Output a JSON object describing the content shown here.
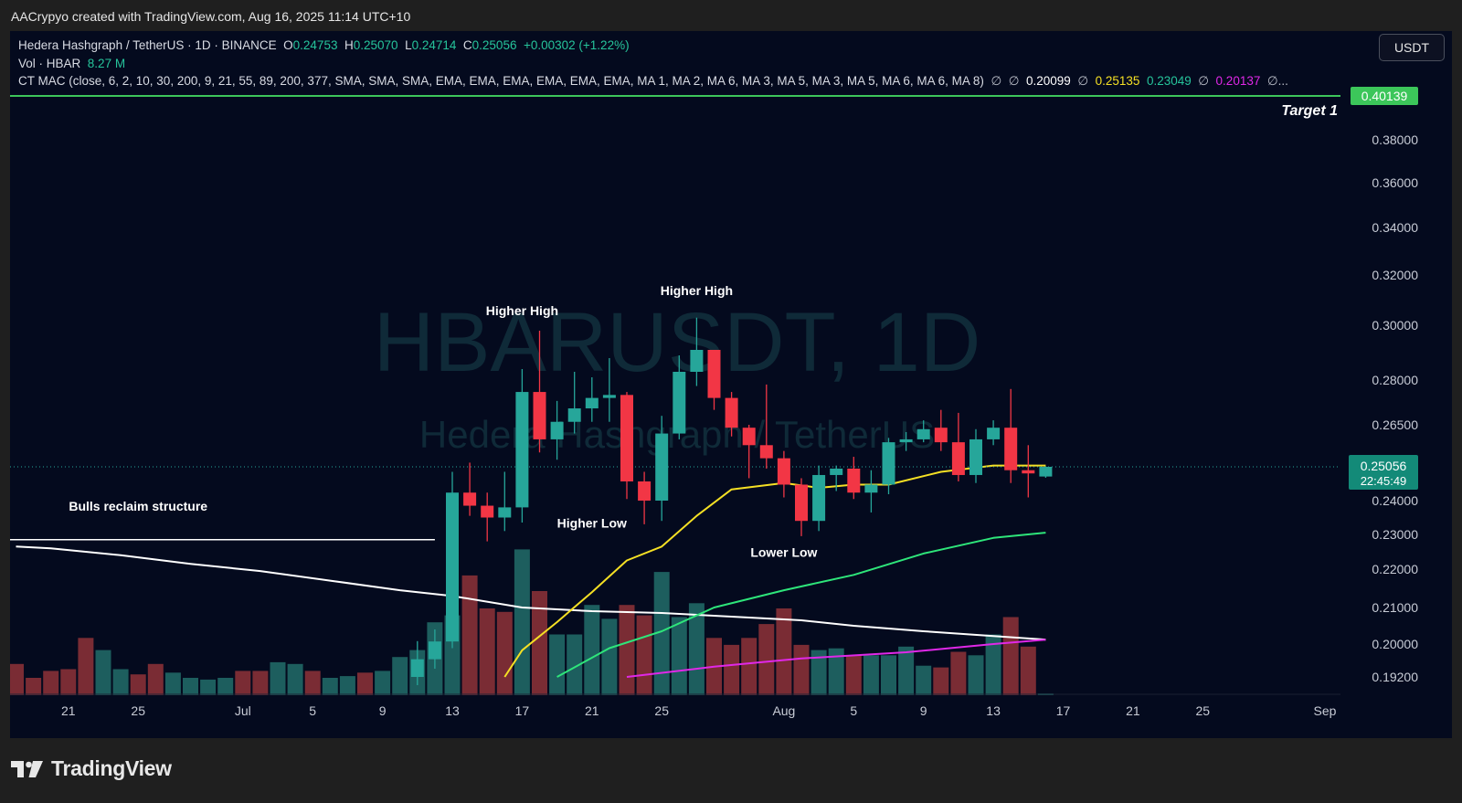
{
  "header": {
    "attribution": "AACrypyo created with TradingView.com, Aug 16, 2025 11:14 UTC+10"
  },
  "legend": {
    "symbol": "Hedera Hashgraph / TetherUS · 1D · BINANCE",
    "o_label": "O",
    "o": "0.24753",
    "h_label": "H",
    "h": "0.25070",
    "l_label": "L",
    "l": "0.24714",
    "c_label": "C",
    "c": "0.25056",
    "change": "+0.00302 (+1.22%)",
    "vol_label": "Vol · HBAR",
    "vol": "8.27 M",
    "indicator": "CT MAC (close, 6, 2, 10, 30, 200, 9, 21, 55, 89, 200, 377, SMA, SMA, SMA, EMA, EMA, EMA, EMA, EMA, EMA, MA 1, MA 2, MA 6, MA 3, MA 5, MA 3, MA 5, MA 6, MA 6, MA 8)",
    "ind_na1": "∅",
    "ind_na2": "∅",
    "ind_v1": "0.20099",
    "ind_na3": "∅",
    "ind_v2": "0.25135",
    "ind_v3": "0.23049",
    "ind_na4": "∅",
    "ind_v4": "0.20137",
    "ind_tail": "∅..."
  },
  "toolbar": {
    "currency": "USDT"
  },
  "watermark": {
    "ticker": "HBARUSDT, 1D",
    "name": "Hedera Hashgraph / TetherUS"
  },
  "colors": {
    "up": "#26a69a",
    "down": "#f23645",
    "ma_yellow": "#f5e024",
    "ma_green": "#2ee57a",
    "ma_white": "#ffffff",
    "ma_magenta": "#e028e8",
    "target": "#3cc65a"
  },
  "chart_data": {
    "type": "candlestick",
    "y_axis_ticks": [
      0.192,
      0.2,
      0.21,
      0.22,
      0.23,
      0.24,
      0.265,
      0.28,
      0.3,
      0.32,
      0.34,
      0.36,
      0.38
    ],
    "y_axis_tick_labels": [
      "0.19200",
      "0.20000",
      "0.21000",
      "0.22000",
      "0.23000",
      "0.24000",
      "0.26500",
      "0.28000",
      "0.30000",
      "0.32000",
      "0.34000",
      "0.36000",
      "0.38000"
    ],
    "x_axis_labels": [
      {
        "date": "2025-06-21",
        "label": "21"
      },
      {
        "date": "2025-06-25",
        "label": "25"
      },
      {
        "date": "2025-07-01",
        "label": "Jul"
      },
      {
        "date": "2025-07-05",
        "label": "5"
      },
      {
        "date": "2025-07-09",
        "label": "9"
      },
      {
        "date": "2025-07-13",
        "label": "13"
      },
      {
        "date": "2025-07-17",
        "label": "17"
      },
      {
        "date": "2025-07-21",
        "label": "21"
      },
      {
        "date": "2025-07-25",
        "label": "25"
      },
      {
        "date": "2025-08-01",
        "label": "Aug"
      },
      {
        "date": "2025-08-05",
        "label": "5"
      },
      {
        "date": "2025-08-09",
        "label": "9"
      },
      {
        "date": "2025-08-13",
        "label": "13"
      },
      {
        "date": "2025-08-17",
        "label": "17"
      },
      {
        "date": "2025-08-21",
        "label": "21"
      },
      {
        "date": "2025-08-25",
        "label": "25"
      },
      {
        "date": "2025-09-01",
        "label": "Sep"
      }
    ],
    "candles": [
      {
        "date": "2025-07-11",
        "o": 0.192,
        "h": 0.2008,
        "l": 0.19,
        "c": 0.1963
      },
      {
        "date": "2025-07-12",
        "o": 0.1963,
        "h": 0.204,
        "l": 0.194,
        "c": 0.2007
      },
      {
        "date": "2025-07-13",
        "o": 0.2007,
        "h": 0.249,
        "l": 0.199,
        "c": 0.2425
      },
      {
        "date": "2025-07-14",
        "o": 0.2425,
        "h": 0.252,
        "l": 0.2355,
        "c": 0.2385
      },
      {
        "date": "2025-07-15",
        "o": 0.2385,
        "h": 0.2425,
        "l": 0.228,
        "c": 0.235
      },
      {
        "date": "2025-07-16",
        "o": 0.235,
        "h": 0.249,
        "l": 0.231,
        "c": 0.238
      },
      {
        "date": "2025-07-17",
        "o": 0.238,
        "h": 0.284,
        "l": 0.2335,
        "c": 0.276
      },
      {
        "date": "2025-07-18",
        "o": 0.276,
        "h": 0.298,
        "l": 0.2555,
        "c": 0.26
      },
      {
        "date": "2025-07-19",
        "o": 0.26,
        "h": 0.273,
        "l": 0.253,
        "c": 0.266
      },
      {
        "date": "2025-07-20",
        "o": 0.266,
        "h": 0.283,
        "l": 0.262,
        "c": 0.2705
      },
      {
        "date": "2025-07-21",
        "o": 0.2705,
        "h": 0.281,
        "l": 0.266,
        "c": 0.274
      },
      {
        "date": "2025-07-22",
        "o": 0.274,
        "h": 0.288,
        "l": 0.266,
        "c": 0.275
      },
      {
        "date": "2025-07-23",
        "o": 0.275,
        "h": 0.276,
        "l": 0.2405,
        "c": 0.246
      },
      {
        "date": "2025-07-24",
        "o": 0.246,
        "h": 0.249,
        "l": 0.233,
        "c": 0.24
      },
      {
        "date": "2025-07-25",
        "o": 0.24,
        "h": 0.268,
        "l": 0.234,
        "c": 0.262
      },
      {
        "date": "2025-07-26",
        "o": 0.262,
        "h": 0.289,
        "l": 0.26,
        "c": 0.283
      },
      {
        "date": "2025-07-27",
        "o": 0.283,
        "h": 0.303,
        "l": 0.278,
        "c": 0.291
      },
      {
        "date": "2025-07-28",
        "o": 0.291,
        "h": 0.291,
        "l": 0.27,
        "c": 0.274
      },
      {
        "date": "2025-07-29",
        "o": 0.274,
        "h": 0.276,
        "l": 0.261,
        "c": 0.264
      },
      {
        "date": "2025-07-30",
        "o": 0.264,
        "h": 0.265,
        "l": 0.247,
        "c": 0.258
      },
      {
        "date": "2025-07-31",
        "o": 0.258,
        "h": 0.2785,
        "l": 0.25,
        "c": 0.2535
      },
      {
        "date": "2025-08-01",
        "o": 0.2535,
        "h": 0.256,
        "l": 0.241,
        "c": 0.245
      },
      {
        "date": "2025-08-02",
        "o": 0.245,
        "h": 0.247,
        "l": 0.2295,
        "c": 0.234
      },
      {
        "date": "2025-08-03",
        "o": 0.234,
        "h": 0.251,
        "l": 0.231,
        "c": 0.248
      },
      {
        "date": "2025-08-04",
        "o": 0.248,
        "h": 0.251,
        "l": 0.243,
        "c": 0.25
      },
      {
        "date": "2025-08-05",
        "o": 0.25,
        "h": 0.254,
        "l": 0.2405,
        "c": 0.2425
      },
      {
        "date": "2025-08-06",
        "o": 0.2425,
        "h": 0.2495,
        "l": 0.2365,
        "c": 0.245
      },
      {
        "date": "2025-08-07",
        "o": 0.245,
        "h": 0.2605,
        "l": 0.242,
        "c": 0.259
      },
      {
        "date": "2025-08-08",
        "o": 0.259,
        "h": 0.2625,
        "l": 0.256,
        "c": 0.26
      },
      {
        "date": "2025-08-09",
        "o": 0.26,
        "h": 0.2665,
        "l": 0.259,
        "c": 0.2635
      },
      {
        "date": "2025-08-10",
        "o": 0.264,
        "h": 0.27,
        "l": 0.256,
        "c": 0.259
      },
      {
        "date": "2025-08-11",
        "o": 0.259,
        "h": 0.269,
        "l": 0.246,
        "c": 0.248
      },
      {
        "date": "2025-08-12",
        "o": 0.248,
        "h": 0.2635,
        "l": 0.2455,
        "c": 0.26
      },
      {
        "date": "2025-08-13",
        "o": 0.26,
        "h": 0.2665,
        "l": 0.258,
        "c": 0.264
      },
      {
        "date": "2025-08-14",
        "o": 0.264,
        "h": 0.277,
        "l": 0.2455,
        "c": 0.2495
      },
      {
        "date": "2025-08-15",
        "o": 0.2495,
        "h": 0.258,
        "l": 0.241,
        "c": 0.2485
      },
      {
        "date": "2025-08-16",
        "o": 0.24753,
        "h": 0.2507,
        "l": 0.24714,
        "c": 0.25056
      }
    ],
    "volume_bars": [
      {
        "date": "2025-06-18",
        "v": 1.8,
        "up": false
      },
      {
        "date": "2025-06-19",
        "v": 1.0,
        "up": false
      },
      {
        "date": "2025-06-20",
        "v": 1.4,
        "up": false
      },
      {
        "date": "2025-06-21",
        "v": 1.5,
        "up": false
      },
      {
        "date": "2025-06-22",
        "v": 3.3,
        "up": false
      },
      {
        "date": "2025-06-23",
        "v": 2.6,
        "up": true
      },
      {
        "date": "2025-06-24",
        "v": 1.5,
        "up": true
      },
      {
        "date": "2025-06-25",
        "v": 1.2,
        "up": false
      },
      {
        "date": "2025-06-26",
        "v": 1.8,
        "up": false
      },
      {
        "date": "2025-06-27",
        "v": 1.3,
        "up": true
      },
      {
        "date": "2025-06-28",
        "v": 1.0,
        "up": true
      },
      {
        "date": "2025-06-29",
        "v": 0.9,
        "up": true
      },
      {
        "date": "2025-06-30",
        "v": 1.0,
        "up": true
      },
      {
        "date": "2025-07-01",
        "v": 1.4,
        "up": false
      },
      {
        "date": "2025-07-02",
        "v": 1.4,
        "up": false
      },
      {
        "date": "2025-07-03",
        "v": 1.9,
        "up": true
      },
      {
        "date": "2025-07-04",
        "v": 1.8,
        "up": true
      },
      {
        "date": "2025-07-05",
        "v": 1.4,
        "up": false
      },
      {
        "date": "2025-07-06",
        "v": 1.0,
        "up": true
      },
      {
        "date": "2025-07-07",
        "v": 1.1,
        "up": true
      },
      {
        "date": "2025-07-08",
        "v": 1.3,
        "up": false
      },
      {
        "date": "2025-07-09",
        "v": 1.4,
        "up": true
      },
      {
        "date": "2025-07-10",
        "v": 2.2,
        "up": true
      },
      {
        "date": "2025-07-11",
        "v": 2.6,
        "up": true
      },
      {
        "date": "2025-07-12",
        "v": 4.2,
        "up": true
      },
      {
        "date": "2025-07-13",
        "v": 4.6,
        "up": true
      },
      {
        "date": "2025-07-14",
        "v": 6.9,
        "up": false
      },
      {
        "date": "2025-07-15",
        "v": 5.0,
        "up": false
      },
      {
        "date": "2025-07-16",
        "v": 4.8,
        "up": false
      },
      {
        "date": "2025-07-17",
        "v": 8.4,
        "up": true
      },
      {
        "date": "2025-07-18",
        "v": 6.0,
        "up": false
      },
      {
        "date": "2025-07-19",
        "v": 3.5,
        "up": true
      },
      {
        "date": "2025-07-20",
        "v": 3.5,
        "up": true
      },
      {
        "date": "2025-07-21",
        "v": 5.2,
        "up": true
      },
      {
        "date": "2025-07-22",
        "v": 4.4,
        "up": true
      },
      {
        "date": "2025-07-23",
        "v": 5.2,
        "up": false
      },
      {
        "date": "2025-07-24",
        "v": 4.6,
        "up": false
      },
      {
        "date": "2025-07-25",
        "v": 7.1,
        "up": true
      },
      {
        "date": "2025-07-26",
        "v": 4.5,
        "up": true
      },
      {
        "date": "2025-07-27",
        "v": 5.3,
        "up": true
      },
      {
        "date": "2025-07-28",
        "v": 3.3,
        "up": false
      },
      {
        "date": "2025-07-29",
        "v": 2.9,
        "up": false
      },
      {
        "date": "2025-07-30",
        "v": 3.3,
        "up": false
      },
      {
        "date": "2025-07-31",
        "v": 4.1,
        "up": false
      },
      {
        "date": "2025-08-01",
        "v": 5.0,
        "up": false
      },
      {
        "date": "2025-08-02",
        "v": 2.9,
        "up": false
      },
      {
        "date": "2025-08-03",
        "v": 2.6,
        "up": true
      },
      {
        "date": "2025-08-04",
        "v": 2.7,
        "up": true
      },
      {
        "date": "2025-08-05",
        "v": 2.3,
        "up": false
      },
      {
        "date": "2025-08-06",
        "v": 2.3,
        "up": true
      },
      {
        "date": "2025-08-07",
        "v": 2.3,
        "up": true
      },
      {
        "date": "2025-08-08",
        "v": 2.8,
        "up": true
      },
      {
        "date": "2025-08-09",
        "v": 1.7,
        "up": true
      },
      {
        "date": "2025-08-10",
        "v": 1.6,
        "up": false
      },
      {
        "date": "2025-08-11",
        "v": 2.5,
        "up": false
      },
      {
        "date": "2025-08-12",
        "v": 2.3,
        "up": true
      },
      {
        "date": "2025-08-13",
        "v": 3.5,
        "up": true
      },
      {
        "date": "2025-08-14",
        "v": 4.5,
        "up": false
      },
      {
        "date": "2025-08-15",
        "v": 2.8,
        "up": false
      },
      {
        "date": "2025-08-16",
        "v": 0.1,
        "up": true
      }
    ],
    "moving_averages": [
      {
        "color": "#ffffff",
        "points": [
          [
            "2025-06-18",
            0.2265
          ],
          [
            "2025-06-20",
            0.226
          ],
          [
            "2025-06-24",
            0.224
          ],
          [
            "2025-06-28",
            0.2215
          ],
          [
            "2025-07-02",
            0.2195
          ],
          [
            "2025-07-06",
            0.217
          ],
          [
            "2025-07-10",
            0.2145
          ],
          [
            "2025-07-13",
            0.213
          ],
          [
            "2025-07-17",
            0.21
          ],
          [
            "2025-07-21",
            0.209
          ],
          [
            "2025-07-25",
            0.2085
          ],
          [
            "2025-07-29",
            0.2075
          ],
          [
            "2025-08-02",
            0.2065
          ],
          [
            "2025-08-05",
            0.205
          ],
          [
            "2025-08-09",
            0.2035
          ],
          [
            "2025-08-13",
            0.2022
          ],
          [
            "2025-08-16",
            0.2012
          ]
        ]
      },
      {
        "color": "#f5e024",
        "points": [
          [
            "2025-07-16",
            0.192
          ],
          [
            "2025-07-17",
            0.1985
          ],
          [
            "2025-07-19",
            0.206
          ],
          [
            "2025-07-21",
            0.214
          ],
          [
            "2025-07-23",
            0.2225
          ],
          [
            "2025-07-25",
            0.2265
          ],
          [
            "2025-07-27",
            0.2355
          ],
          [
            "2025-07-29",
            0.2435
          ],
          [
            "2025-08-01",
            0.2455
          ],
          [
            "2025-08-03",
            0.244
          ],
          [
            "2025-08-05",
            0.245
          ],
          [
            "2025-08-07",
            0.245
          ],
          [
            "2025-08-10",
            0.249
          ],
          [
            "2025-08-13",
            0.251
          ],
          [
            "2025-08-16",
            0.251
          ]
        ]
      },
      {
        "color": "#2ee57a",
        "points": [
          [
            "2025-07-19",
            0.192
          ],
          [
            "2025-07-22",
            0.199
          ],
          [
            "2025-07-25",
            0.2035
          ],
          [
            "2025-07-28",
            0.21
          ],
          [
            "2025-08-01",
            0.2145
          ],
          [
            "2025-08-05",
            0.2185
          ],
          [
            "2025-08-09",
            0.2245
          ],
          [
            "2025-08-13",
            0.229
          ],
          [
            "2025-08-16",
            0.2305
          ]
        ]
      },
      {
        "color": "#e028e8",
        "points": [
          [
            "2025-07-23",
            0.192
          ],
          [
            "2025-07-28",
            0.1945
          ],
          [
            "2025-08-02",
            0.1965
          ],
          [
            "2025-08-08",
            0.198
          ],
          [
            "2025-08-13",
            0.2
          ],
          [
            "2025-08-16",
            0.2012
          ]
        ]
      }
    ],
    "reclaim_level": {
      "from": "2025-06-18",
      "to": "2025-07-12",
      "value": 0.2285
    },
    "target_line": {
      "value": 0.40139
    },
    "last_price_line": {
      "value": 0.25056
    },
    "annotations": [
      {
        "text": "Bulls reclaim structure",
        "date": "2025-06-25",
        "value": 0.237
      },
      {
        "text": "Higher High",
        "date": "2025-07-17",
        "value": 0.304
      },
      {
        "text": "Higher High",
        "date": "2025-07-27",
        "value": 0.312
      },
      {
        "text": "Higher Low",
        "date": "2025-07-21",
        "value": 0.232
      },
      {
        "text": "Lower Low",
        "date": "2025-08-01",
        "value": 0.2235
      }
    ],
    "target_label": "Target 1",
    "target_price_label": "0.40139",
    "last_price_label": "0.25056",
    "countdown_label": "22:45:49"
  }
}
